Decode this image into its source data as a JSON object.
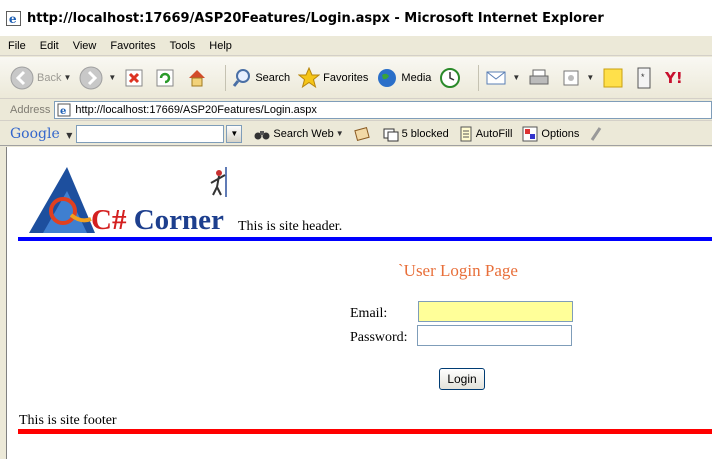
{
  "window": {
    "title": "http://localhost:17669/ASP20Features/Login.aspx - Microsoft Internet Explorer"
  },
  "menu": [
    "File",
    "Edit",
    "View",
    "Favorites",
    "Tools",
    "Help"
  ],
  "toolbar": {
    "back": "Back",
    "search": "Search",
    "favorites": "Favorites",
    "media": "Media"
  },
  "address": {
    "label": "Address",
    "url": "http://localhost:17669/ASP20Features/Login.aspx"
  },
  "google_toolbar": {
    "logo": "Google",
    "search_web": "Search Web",
    "blocked": "5 blocked",
    "autofill": "AutoFill",
    "options": "Options"
  },
  "page": {
    "logo_text": "C# Corner",
    "header_text": "This is site header.",
    "login_title": "`User Login Page",
    "email_label": "Email:",
    "password_label": "Password:",
    "email_value": "",
    "password_value": "",
    "login_button": "Login",
    "footer_text": "This is site footer"
  },
  "colors": {
    "header_rule": "#0000ff",
    "footer_rule": "#ff0000",
    "login_title": "#e86f3a",
    "email_field_bg": "#ffff99"
  }
}
